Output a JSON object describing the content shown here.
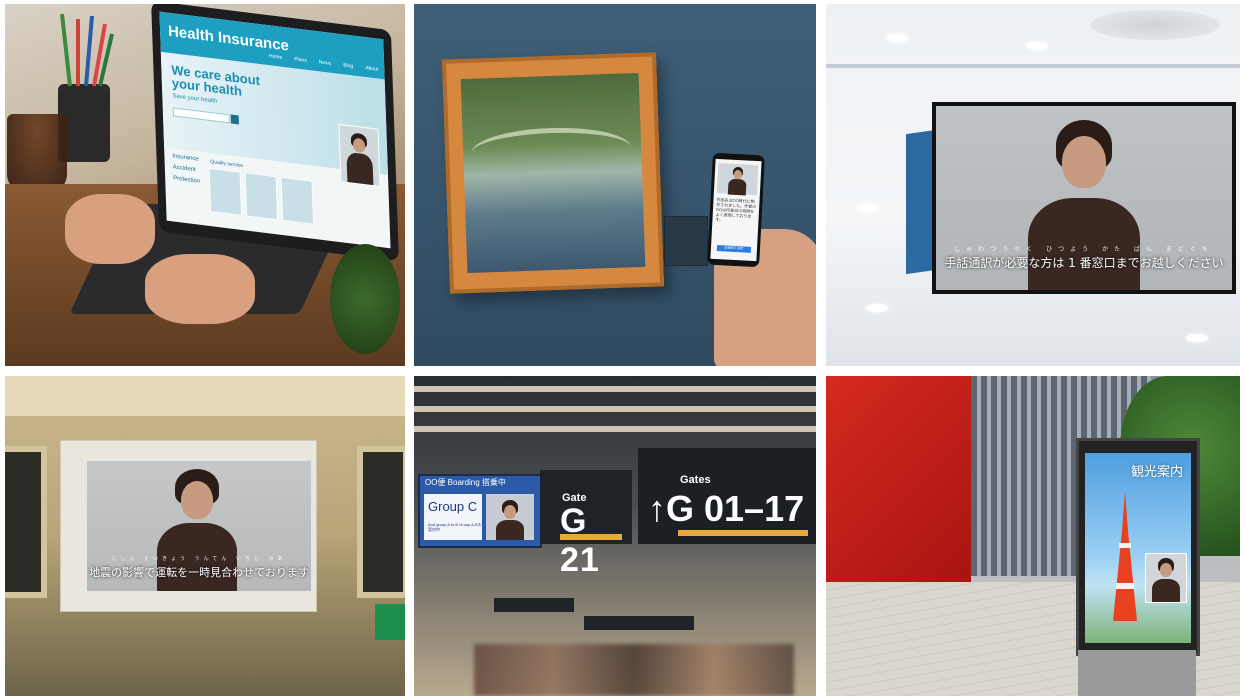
{
  "panels": {
    "laptop": {
      "site_logo": "Health Insurance",
      "nav": [
        "Home",
        "Plans",
        "News",
        "Blog",
        "About"
      ],
      "tagline": "We care about your health",
      "sub": "Save your health",
      "list": [
        "Insurance",
        "Accident",
        "Protection"
      ],
      "cards_title": "Quality service"
    },
    "museum": {
      "phone_text": "作品名はOO時代に制作されました。作者のOOは印象派の特徴をよく表現しております。",
      "phone_button": "詳細表示 設定",
      "phone_bottom": "Next"
    },
    "airport_hanging": {
      "ruby": "しゅわつうやく ひつよう かた ばん まどぐち",
      "caption": "手話通訳が必要な方は 1 番窓口までお越しください"
    },
    "train": {
      "ruby": "じしん えいきょう うんてん いちじ みあ",
      "caption": "地震の影響で運転を一時見合わせております"
    },
    "gates": {
      "board_head": "OO便    Boarding 搭乗中",
      "group_name": "Group C",
      "group_sub": "And group A to B Group A-Bも案内中",
      "gate_small": "Gate",
      "gate_big": "G 21",
      "gates_small": "Gates",
      "gates_big": "↑G 01–17"
    },
    "kiosk": {
      "title": "観光案内"
    }
  }
}
